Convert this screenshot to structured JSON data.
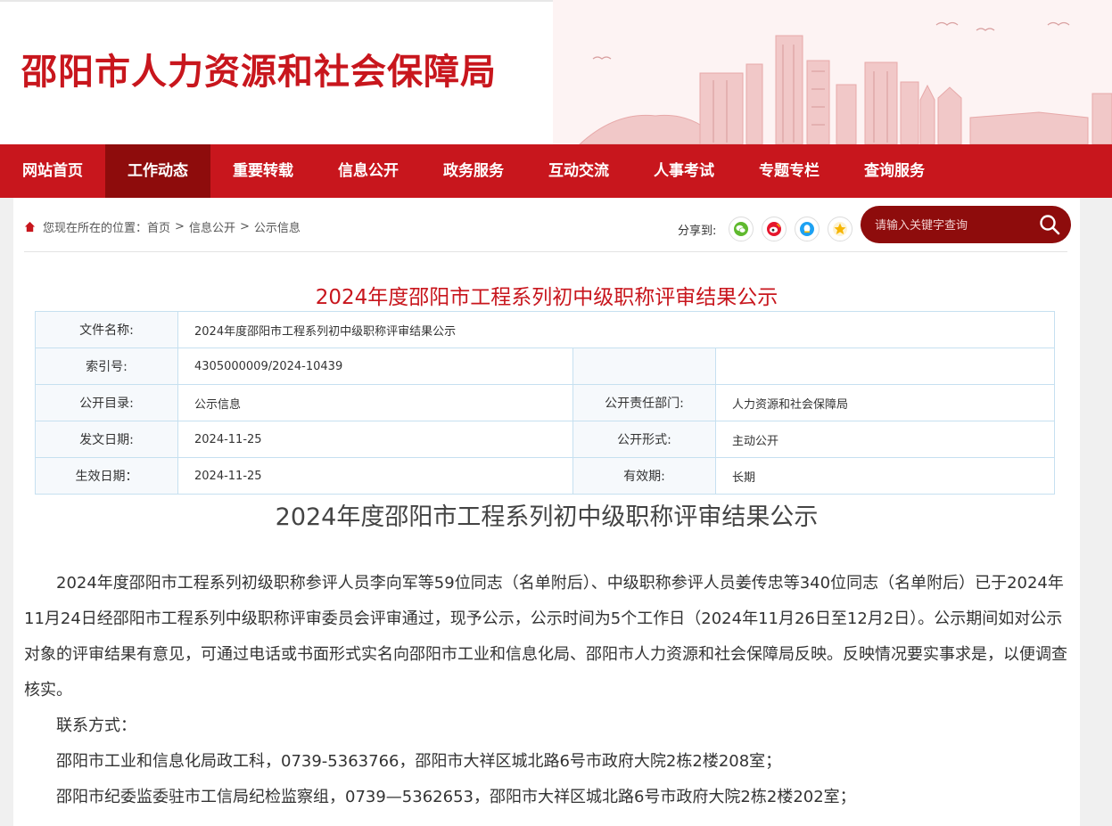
{
  "header": {
    "site_title": "邵阳市人力资源和社会保障局"
  },
  "nav": {
    "items": [
      {
        "label": "网站首页",
        "name": "home"
      },
      {
        "label": "工作动态",
        "name": "work-news",
        "active": true
      },
      {
        "label": "重要转载",
        "name": "reprints"
      },
      {
        "label": "信息公开",
        "name": "info-disclosure"
      },
      {
        "label": "政务服务",
        "name": "gov-services"
      },
      {
        "label": "互动交流",
        "name": "interaction"
      },
      {
        "label": "人事考试",
        "name": "exams"
      },
      {
        "label": "专题专栏",
        "name": "special-topics"
      },
      {
        "label": "查询服务",
        "name": "query-services"
      }
    ]
  },
  "breadcrumb": {
    "prefix": "您现在所在的位置：",
    "items": [
      "首页",
      "信息公开",
      "公示信息"
    ],
    "separator": ">"
  },
  "share": {
    "label": "分享到:",
    "icons": [
      "wechat-icon",
      "weibo-icon",
      "qq-icon",
      "qzone-icon"
    ]
  },
  "search": {
    "placeholder": "请输入关键字查询"
  },
  "doc_title": "2024年度邵阳市工程系列初中级职称评审结果公示",
  "meta": {
    "file_name_label": "文件名称:",
    "file_name_value": "2024年度邵阳市工程系列初中级职称评审结果公示",
    "index_label": "索引号:",
    "index_value": "4305000009/2024-10439",
    "catalog_label": "公开目录:",
    "catalog_value": "公示信息",
    "dept_label": "公开责任部门:",
    "dept_value": "人力资源和社会保障局",
    "issue_date_label": "发文日期:",
    "issue_date_value": "2024-11-25",
    "form_label": "公开形式:",
    "form_value": "主动公开",
    "effective_date_label": "生效日期：",
    "effective_date_value": "2024-11-25",
    "validity_label": "有效期:",
    "validity_value": "长期"
  },
  "article": {
    "title": "2024年度邵阳市工程系列初中级职称评审结果公示",
    "paragraph1": "2024年度邵阳市工程系列初级职称参评人员李向军等59位同志（名单附后）、中级职称参评人员姜传忠等340位同志（名单附后）已于2024年11月24日经邵阳市工程系列中级职称评审委员会评审通过，现予公示，公示时间为5个工作日（2024年11月26日至12月2日）。公示期间如对公示对象的评审结果有意见，可通过电话或书面形式实名向邵阳市工业和信息化局、邵阳市人力资源和社会保障局反映。反映情况要实事求是，以便调查核实。",
    "contact_label": "联系方式：",
    "contact1": "邵阳市工业和信息化局政工科，0739-5363766，邵阳市大祥区城北路6号市政府大院2栋2楼208室；",
    "contact2": "邵阳市纪委监委驻市工信局纪检监察组，0739—5362653，邵阳市大祥区城北路6号市政府大院2栋2楼202室；"
  },
  "colors": {
    "brand_red": "#c8161d",
    "dark_red": "#8e0c0c",
    "table_border": "#c6e0f0"
  }
}
